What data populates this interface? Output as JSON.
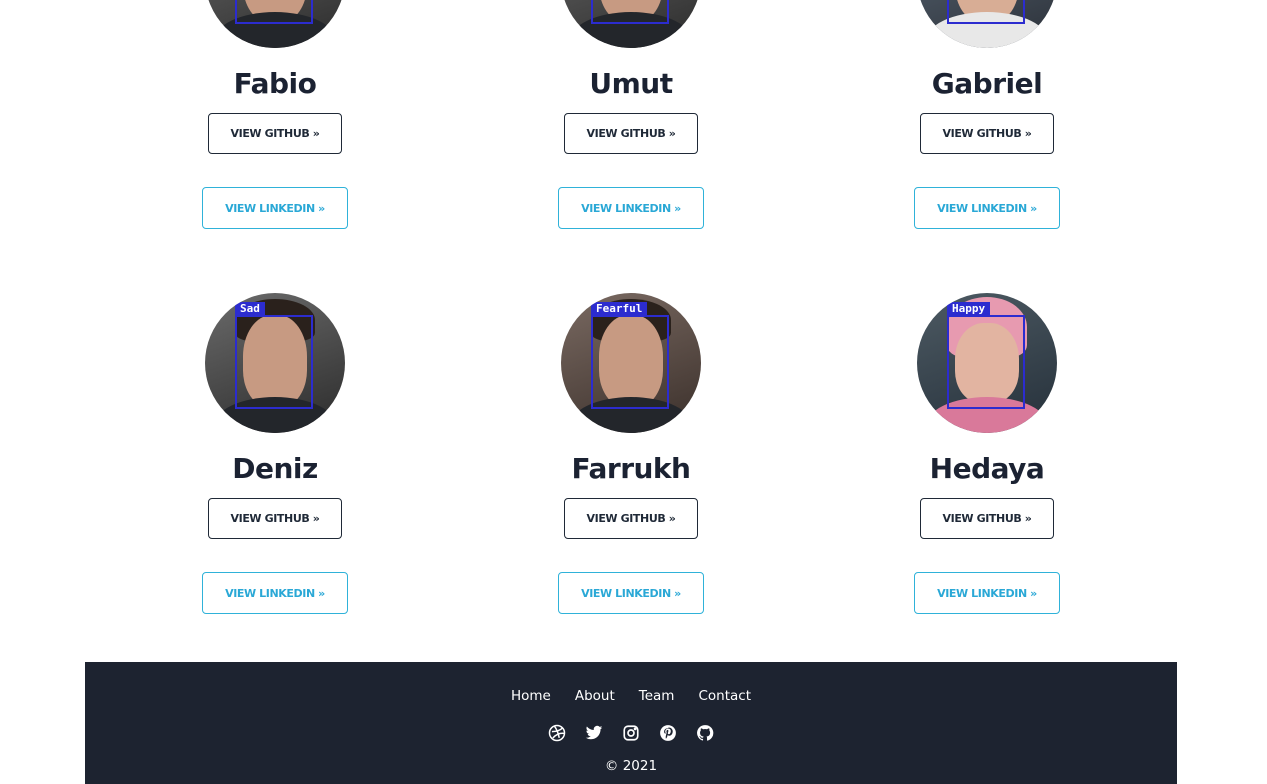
{
  "team": {
    "members": [
      {
        "name": "Fabio",
        "github_label": "VIEW GITHUB »",
        "linkedin_label": "VIEW LINKEDIN »",
        "emotion": ""
      },
      {
        "name": "Umut",
        "github_label": "VIEW GITHUB »",
        "linkedin_label": "VIEW LINKEDIN »",
        "emotion": ""
      },
      {
        "name": "Gabriel",
        "github_label": "VIEW GITHUB »",
        "linkedin_label": "VIEW LINKEDIN »",
        "emotion": ""
      },
      {
        "name": "Deniz",
        "github_label": "VIEW GITHUB »",
        "linkedin_label": "VIEW LINKEDIN »",
        "emotion": "Sad"
      },
      {
        "name": "Farrukh",
        "github_label": "VIEW GITHUB »",
        "linkedin_label": "VIEW LINKEDIN »",
        "emotion": "Fearful"
      },
      {
        "name": "Hedaya",
        "github_label": "VIEW GITHUB »",
        "linkedin_label": "VIEW LINKEDIN »",
        "emotion": "Happy"
      }
    ]
  },
  "footer": {
    "nav": [
      "Home",
      "About",
      "Team",
      "Contact"
    ],
    "social_icons": [
      "dribbble-icon",
      "twitter-icon",
      "instagram-icon",
      "pinterest-icon",
      "github-icon"
    ],
    "copyright": "© 2021"
  },
  "colors": {
    "footer_bg": "#1d2330",
    "linkedin_accent": "#2aa8d6",
    "detection_box": "#2c2ccf"
  }
}
